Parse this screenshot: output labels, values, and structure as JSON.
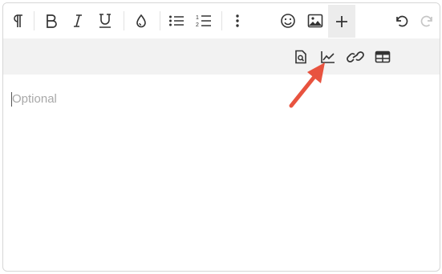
{
  "toolbar": {
    "items": [
      {
        "name": "paragraph-icon"
      },
      {
        "name": "bold-icon"
      },
      {
        "name": "italic-icon"
      },
      {
        "name": "underline-icon"
      },
      {
        "name": "text-color-icon"
      },
      {
        "name": "bullet-list-icon"
      },
      {
        "name": "numbered-list-icon"
      },
      {
        "name": "more-icon"
      },
      {
        "name": "emoji-icon"
      },
      {
        "name": "image-icon"
      },
      {
        "name": "plus-icon"
      },
      {
        "name": "undo-icon"
      },
      {
        "name": "redo-icon"
      }
    ]
  },
  "subbar": {
    "items": [
      {
        "name": "search-document-icon"
      },
      {
        "name": "chart-icon"
      },
      {
        "name": "link-icon"
      },
      {
        "name": "table-icon"
      }
    ]
  },
  "editor": {
    "placeholder": "Optional"
  },
  "colors": {
    "annotation_arrow": "#e8533f",
    "subbar_bg": "#f2f2f2",
    "icon": "#333333"
  }
}
